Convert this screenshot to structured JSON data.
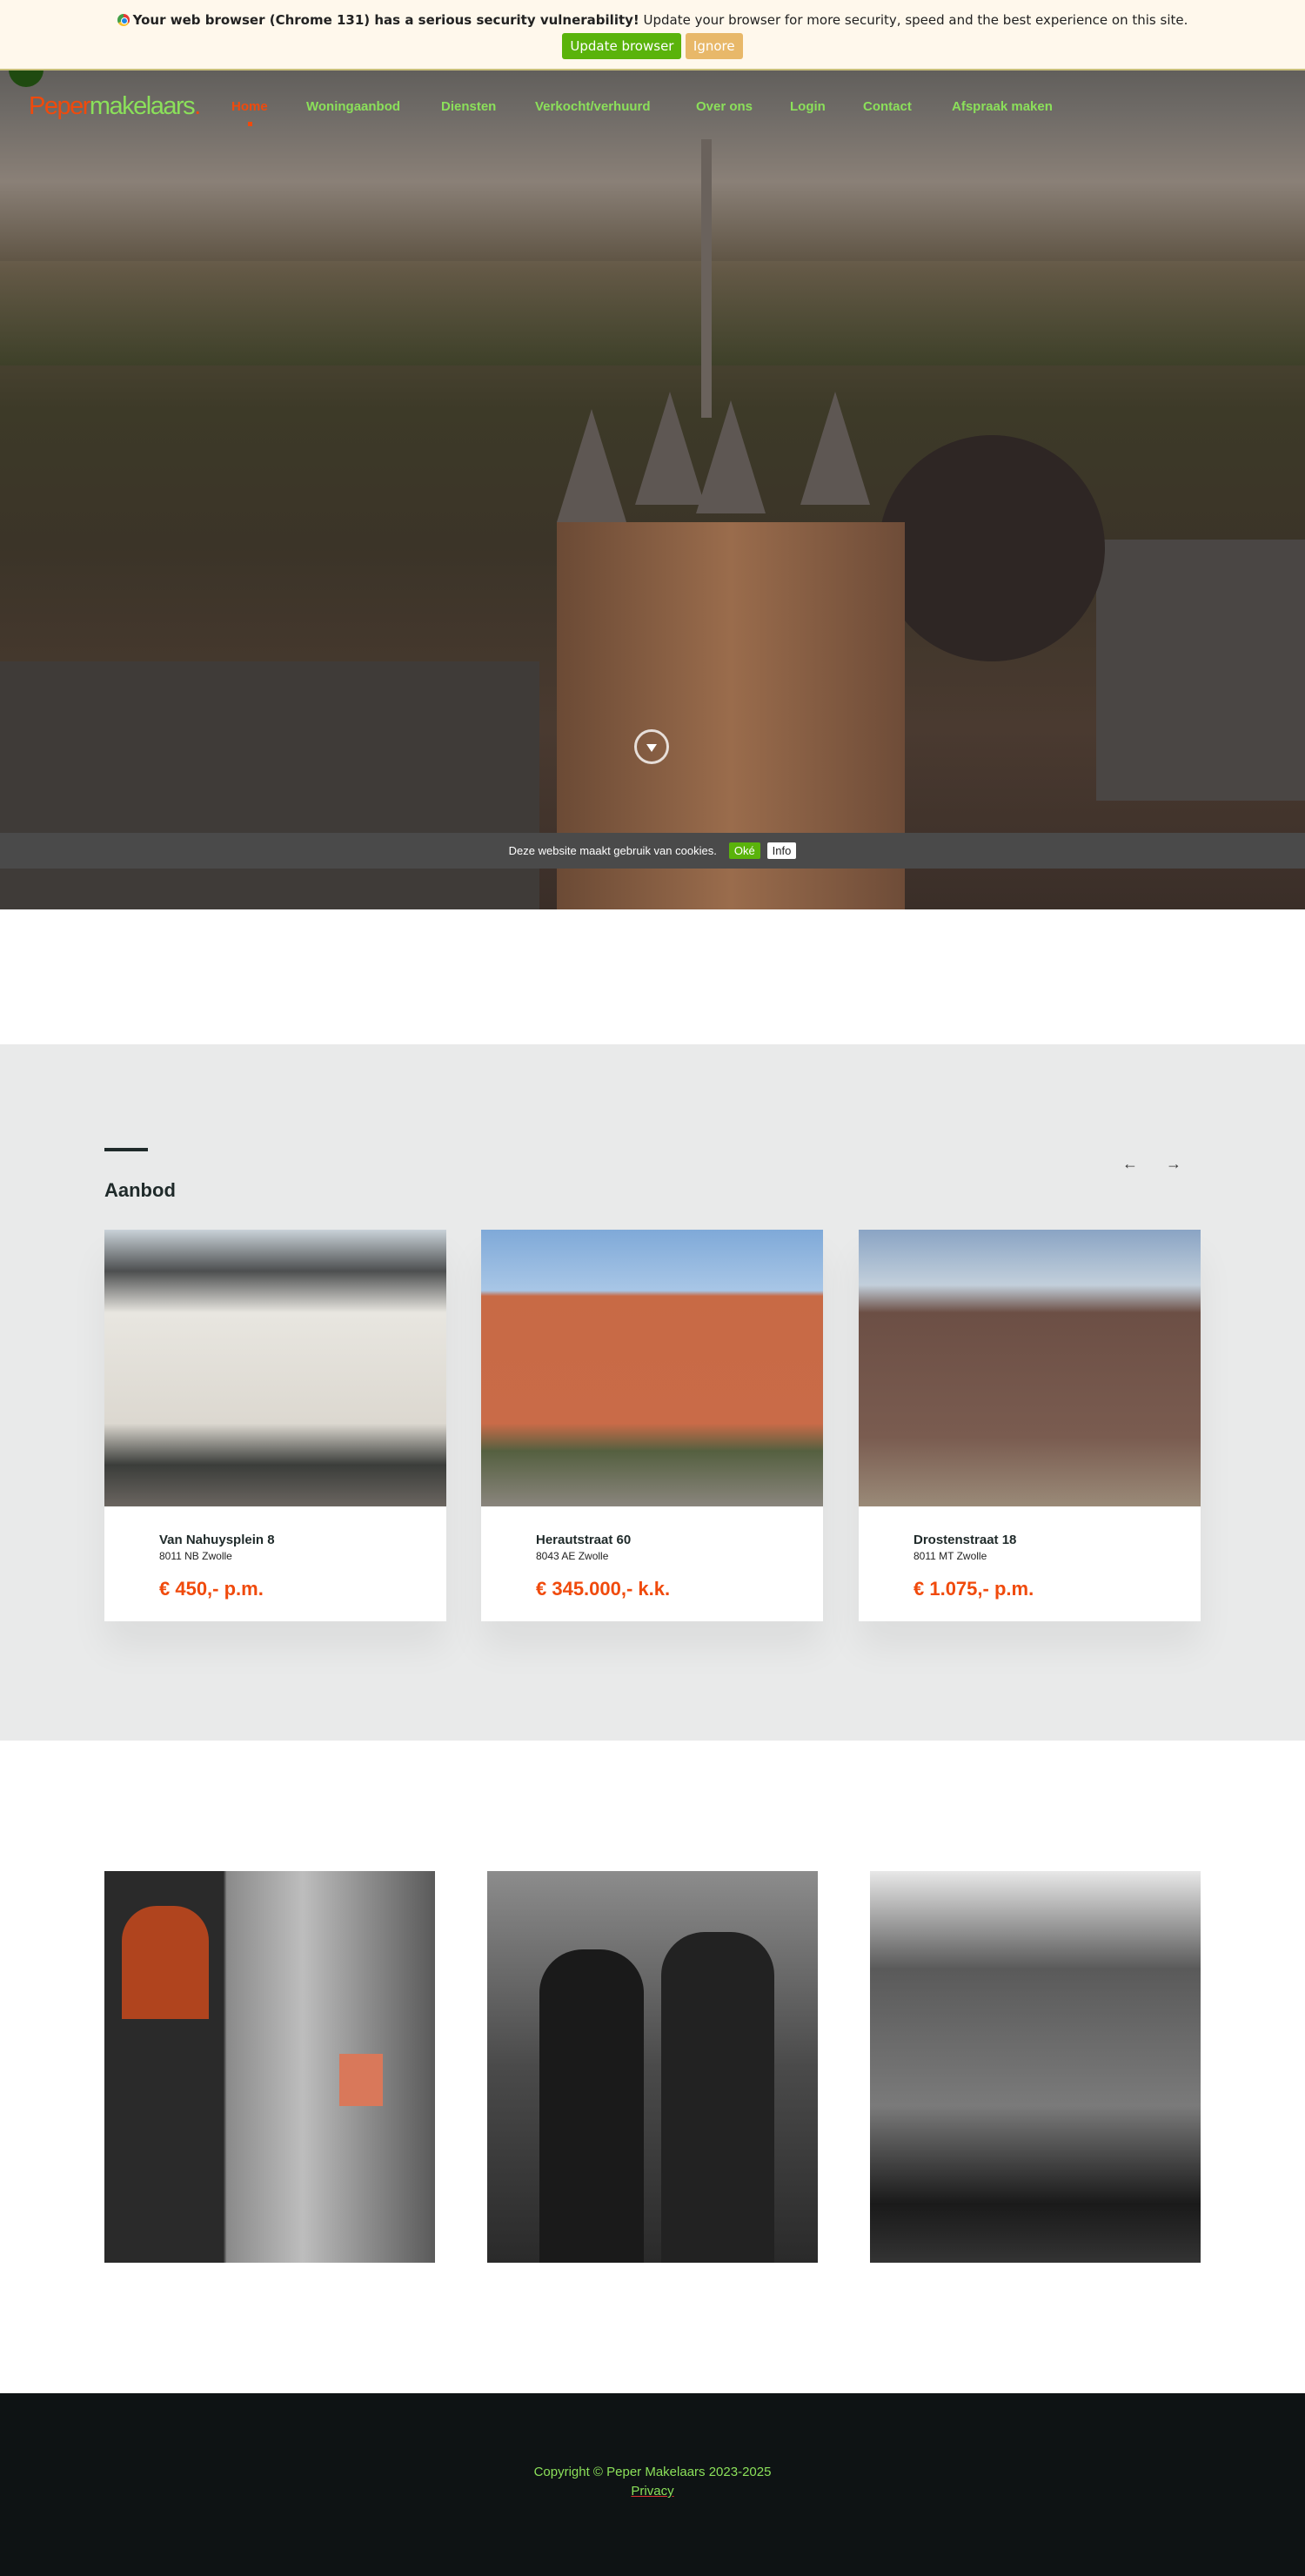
{
  "browser_banner": {
    "bold_text": "Your web browser (Chrome 131) has a serious security vulnerability!",
    "text": " Update your browser for more security, speed and the best experience on this site.",
    "update_label": "Update browser",
    "ignore_label": "Ignore",
    "colors": {
      "background": "#fff8ec",
      "update": "#5ab30b",
      "ignore": "#e8b869"
    }
  },
  "header": {
    "logo": {
      "part1": "Peper",
      "part2": "makelaars",
      "dot": "."
    },
    "nav": [
      {
        "label": "Home",
        "active": true
      },
      {
        "label": "Woningaanbod"
      },
      {
        "label": "Diensten"
      },
      {
        "label": "Verkocht/verhuurd"
      },
      {
        "label": "Over ons"
      },
      {
        "label": "Login"
      },
      {
        "label": "Contact"
      },
      {
        "label": "Afspraak maken"
      }
    ],
    "colors": {
      "accent": "#f04a0c",
      "nav": "#8be05a"
    }
  },
  "cookie_bar": {
    "text": "Deze website maakt gebruik van cookies.",
    "ok_label": "Oké",
    "info_label": "Info"
  },
  "aanbod": {
    "title": "Aanbod",
    "listings": [
      {
        "street": "Van Nahuysplein 8",
        "zip": "8011 NB Zwolle",
        "price": "€ 450,- p.m."
      },
      {
        "street": "Herautstraat 60",
        "zip": "8043 AE Zwolle",
        "price": "€ 345.000,- k.k."
      },
      {
        "street": "Drostenstraat 18",
        "zip": "8011 MT Zwolle",
        "price": "€ 1.075,- p.m."
      }
    ]
  },
  "footer": {
    "copyright": "Copyright © Peper Makelaars 2023-2025",
    "privacy": "Privacy"
  }
}
